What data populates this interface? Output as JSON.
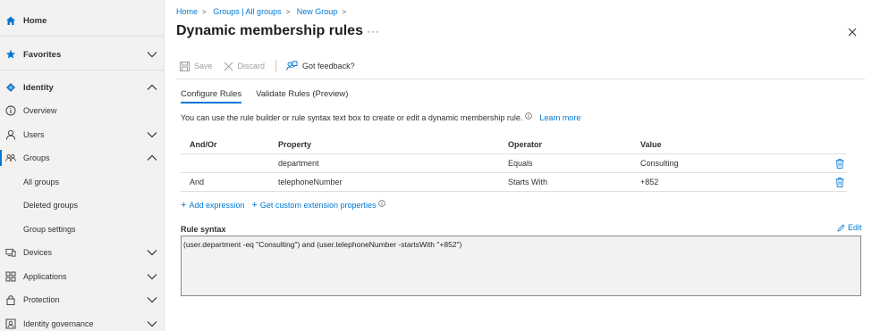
{
  "sidebar": {
    "items": [
      {
        "label": "Home",
        "icon": "home-icon"
      },
      {
        "label": "Favorites",
        "icon": "star-icon"
      },
      {
        "label": "Identity",
        "icon": "identity-icon"
      },
      {
        "label": "Overview",
        "icon": "info-icon"
      },
      {
        "label": "Users",
        "icon": "user-icon"
      },
      {
        "label": "Groups",
        "icon": "groups-icon"
      },
      {
        "label": "All groups"
      },
      {
        "label": "Deleted groups"
      },
      {
        "label": "Group settings"
      },
      {
        "label": "Devices",
        "icon": "devices-icon"
      },
      {
        "label": "Applications",
        "icon": "applications-icon"
      },
      {
        "label": "Protection",
        "icon": "lock-icon"
      },
      {
        "label": "Identity governance",
        "icon": "governance-icon"
      }
    ]
  },
  "breadcrumb": [
    "Home",
    "Groups | All groups",
    "New Group"
  ],
  "title": "Dynamic membership rules",
  "more_label": "···",
  "toolbar": {
    "save": "Save",
    "discard": "Discard",
    "feedback": "Got feedback?"
  },
  "tabs": [
    "Configure Rules",
    "Validate Rules (Preview)"
  ],
  "description": "You can use the rule builder or rule syntax text box to create or edit a dynamic membership rule.",
  "learn_more": "Learn more",
  "table": {
    "headers": [
      "And/Or",
      "Property",
      "Operator",
      "Value"
    ],
    "rows": [
      {
        "andor": "",
        "property": "department",
        "operator": "Equals",
        "value": "Consulting"
      },
      {
        "andor": "And",
        "property": "telephoneNumber",
        "operator": "Starts With",
        "value": "+852"
      }
    ]
  },
  "actions": {
    "add_expression": "Add expression",
    "custom_extension": "Get custom extension properties"
  },
  "rule_syntax": {
    "label": "Rule syntax",
    "edit": "Edit",
    "value": "(user.department -eq \"Consulting\") and (user.telephoneNumber -startsWith \"+852\")"
  },
  "colors": {
    "accent": "#0078d4",
    "sidebar_bg": "#f3f2f1",
    "text": "#323130"
  }
}
